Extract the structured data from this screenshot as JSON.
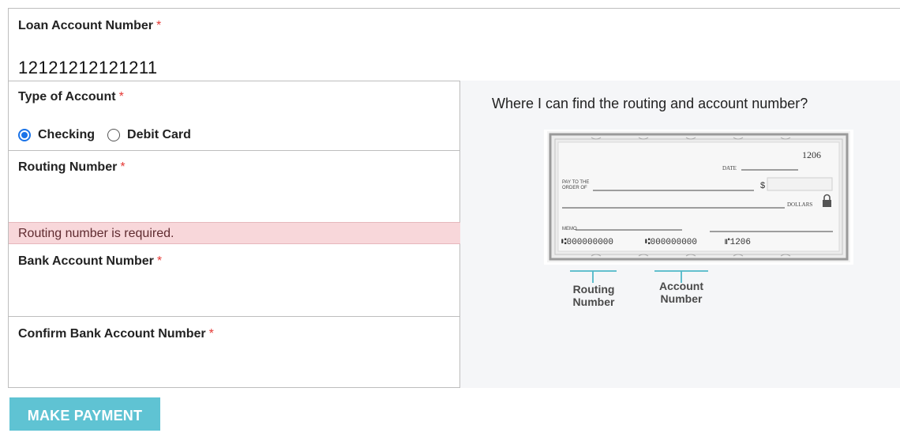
{
  "loan": {
    "label": "Loan Account Number",
    "required_mark": "*",
    "value": "12121212121211"
  },
  "account_type": {
    "label": "Type of Account",
    "required_mark": "*",
    "options": [
      {
        "label": "Checking",
        "selected": true
      },
      {
        "label": "Debit Card",
        "selected": false
      }
    ]
  },
  "routing": {
    "label": "Routing Number",
    "required_mark": "*",
    "value": "",
    "error": "Routing number is required."
  },
  "bank_account": {
    "label": "Bank Account Number",
    "required_mark": "*",
    "value": ""
  },
  "confirm_account": {
    "label": "Confirm Bank Account Number",
    "required_mark": "*",
    "value": ""
  },
  "help": {
    "title": "Where I can find the routing and account number?",
    "cheque": {
      "number": "1206",
      "date_label": "DATE",
      "pay_to_line1": "PAY TO THE",
      "pay_to_line2": "ORDER OF",
      "dollar_sign": "$",
      "dollars_label": "DOLLARS",
      "memo_label": "MEMO",
      "micr_routing": "⑆000000000",
      "micr_account": "⑆000000000",
      "micr_check": "⑈1206"
    },
    "routing_caption_1": "Routing",
    "routing_caption_2": "Number",
    "account_caption_1": "Account",
    "account_caption_2": "Number"
  },
  "submit": {
    "label": "MAKE PAYMENT"
  },
  "colors": {
    "accent": "#5fc3d3",
    "radio": "#1a73e8",
    "required": "#e53935",
    "error_bg": "#f8d7da",
    "panel_bg": "#f5f6f8",
    "caption_line": "#4fb8c8"
  }
}
